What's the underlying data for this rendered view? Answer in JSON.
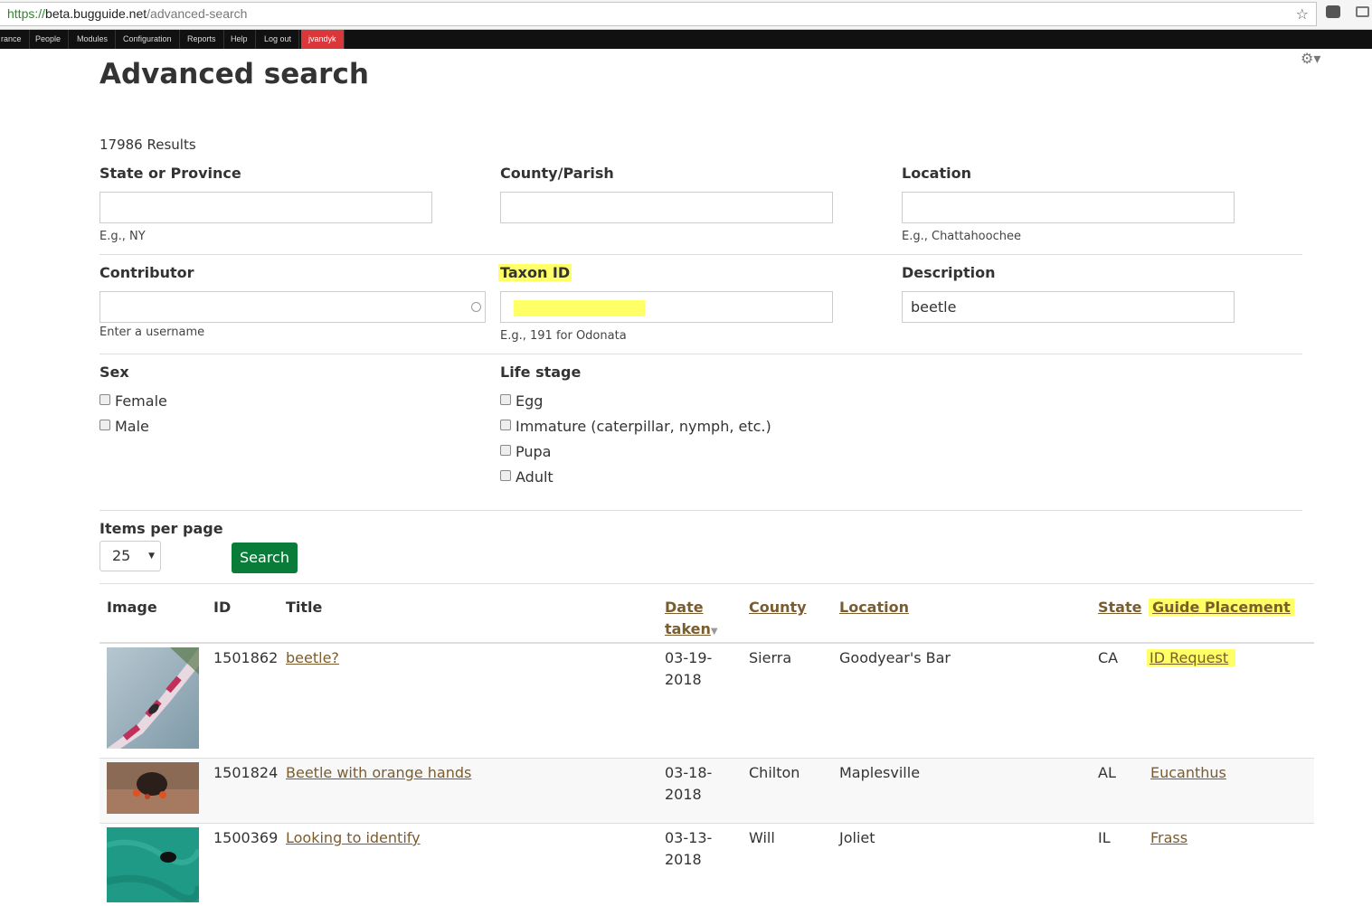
{
  "browser": {
    "url_scheme": "https://",
    "url_host": "beta.bugguide.net",
    "url_path": "/advanced-search"
  },
  "admin_toolbar": {
    "items": [
      "rance",
      "People",
      "Modules",
      "Configuration",
      "Reports",
      "Help",
      "Log out"
    ],
    "user": "jvandyk"
  },
  "page": {
    "title": "Advanced search",
    "results": "17986 Results"
  },
  "filters": {
    "state": {
      "label": "State or Province",
      "value": "",
      "hint": "E.g., NY"
    },
    "county": {
      "label": "County/Parish",
      "value": ""
    },
    "location": {
      "label": "Location",
      "value": "",
      "hint": "E.g., Chattahoochee"
    },
    "contributor": {
      "label": "Contributor",
      "value": "",
      "hint": "Enter a username"
    },
    "taxon": {
      "label": "Taxon ID",
      "value": "",
      "hint": "E.g., 191 for Odonata"
    },
    "description": {
      "label": "Description",
      "value": "beetle"
    },
    "sex": {
      "label": "Sex",
      "options": [
        "Female",
        "Male"
      ]
    },
    "life_stage": {
      "label": "Life stage",
      "options": [
        "Egg",
        "Immature (caterpillar, nymph, etc.)",
        "Pupa",
        "Adult"
      ]
    },
    "items_per_page": {
      "label": "Items per page",
      "value": "25"
    },
    "search_button": "Search"
  },
  "table": {
    "headers": {
      "image": "Image",
      "id": "ID",
      "title": "Title",
      "date_line1": "Date",
      "date_line2": "taken",
      "county": "County",
      "location": "Location",
      "state": "State",
      "guide": "Guide Placement"
    },
    "rows": [
      {
        "id": "1501862",
        "title": "beetle?",
        "date_line1": "03-19-",
        "date_line2": "2018",
        "county": "Sierra",
        "location": "Goodyear's Bar",
        "state": "CA",
        "guide": "ID Request"
      },
      {
        "id": "1501824",
        "title": "Beetle with orange hands",
        "date_line1": "03-18-",
        "date_line2": "2018",
        "county": "Chilton",
        "location": "Maplesville",
        "state": "AL",
        "guide": "Eucanthus"
      },
      {
        "id": "1500369",
        "title": "Looking to identify",
        "date_line1": "03-13-",
        "date_line2": "2018",
        "county": "Will",
        "location": "Joliet",
        "state": "IL",
        "guide": "Frass"
      }
    ]
  }
}
